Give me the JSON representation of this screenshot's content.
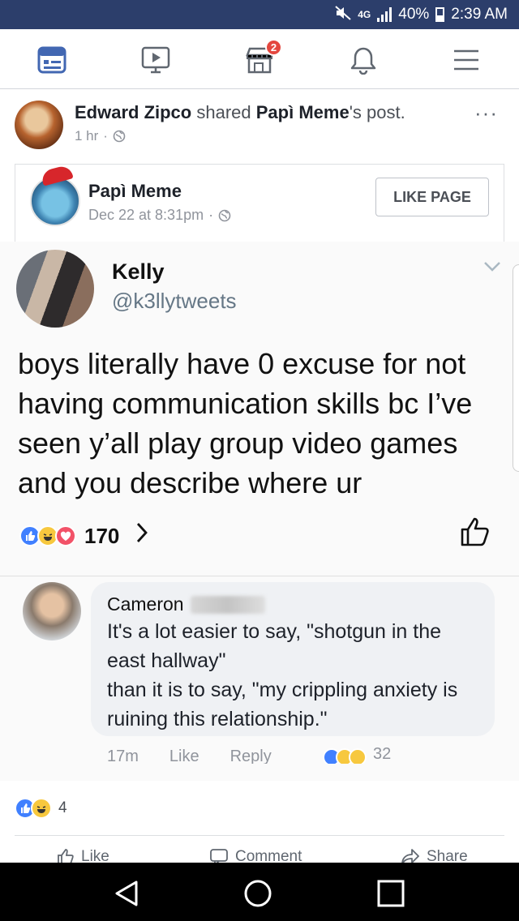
{
  "status_bar": {
    "network": "4G",
    "battery": "40%",
    "time": "2:39 AM"
  },
  "nav": {
    "marketplace_badge": "2"
  },
  "post": {
    "sharer_name": "Edward Zipco",
    "shared_word": " shared ",
    "page_possessive": "Papì Meme",
    "post_word": "'s post.",
    "time": "1 hr",
    "more": "···"
  },
  "shared_page": {
    "name": "Papì Meme",
    "date": "Dec 22 at 8:31pm",
    "like_button": "LIKE PAGE"
  },
  "tweet": {
    "name": "Kelly",
    "handle": "@k3llytweets",
    "text": "boys literally have 0 excuse for not having communication skills bc I’ve seen y’all play group video games and you describe where ur",
    "reaction_count": "170"
  },
  "comment": {
    "author": "Cameron",
    "text_line1": "It's a lot easier to say, \"shotgun in the east hallway\"",
    "text_line2": "than it is to say, \"my crippling anxiety is ruining this relationship.\"",
    "time": "17m",
    "like": "Like",
    "reply": "Reply",
    "reaction_count": "32"
  },
  "post_footer": {
    "reaction_count": "4",
    "like": "Like",
    "comment": "Comment",
    "share": "Share"
  },
  "colors": {
    "status_bar": "#2c3e6b",
    "facebook_blue": "#4267b2",
    "like_blue": "#4080ff",
    "haha_yellow": "#f7c83e",
    "love_red": "#f25268",
    "badge_red": "#e4473f"
  }
}
